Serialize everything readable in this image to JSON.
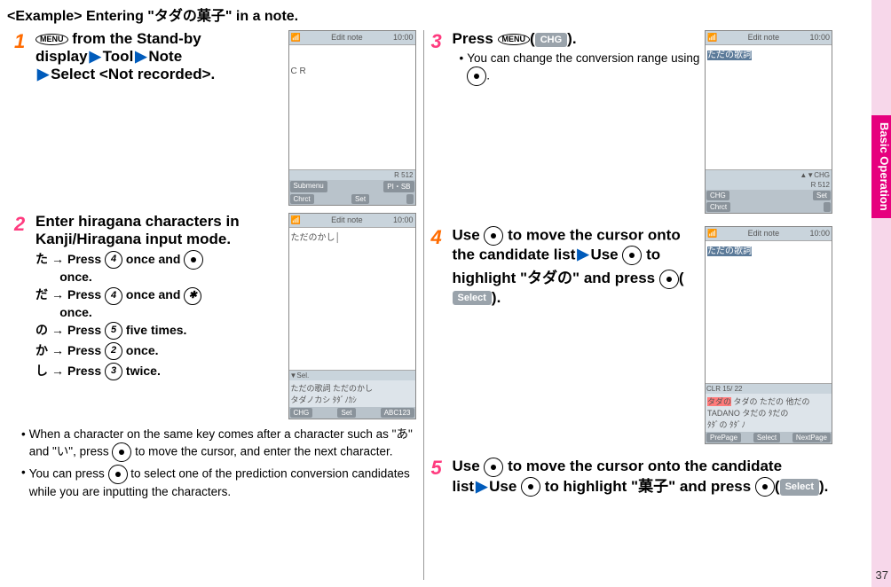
{
  "title": "<Example> Entering \"タダの菓子\" in a note.",
  "side_tab": "Basic Operation",
  "page_number": "37",
  "steps": {
    "s1": {
      "num": "1",
      "parts": {
        "menu": "MENU",
        "t1": " from the Stand-by display",
        "tool": "Tool",
        "note": "Note",
        "select": "Select <Not recorded>."
      }
    },
    "s2": {
      "num": "2",
      "head": "Enter hiragana characters in Kanji/Hiragana input mode.",
      "lines": {
        "l1a": "た",
        "l1b": "Press ",
        "l1key": "4",
        "l1c": " once and ",
        "l1d": " once.",
        "l2a": "だ",
        "l2b": "Press ",
        "l2key": "4",
        "l2c": " once and ",
        "l2star": "✱",
        "l2d": " once.",
        "l3a": "の",
        "l3b": "Press ",
        "l3key": "5",
        "l3c": " five times.",
        "l4a": "か",
        "l4b": "Press ",
        "l4key": "2",
        "l4c": " once.",
        "l5a": "し",
        "l5b": "Press ",
        "l5key": "3",
        "l5c": " twice."
      },
      "b1": "When a character on the same key comes after a character such as \"あ\" and \"い\", press ",
      "b1b": " to move the cursor, and enter the next character.",
      "b2": "You can press ",
      "b2b": " to select one of the prediction conversion candidates while you are inputting the characters."
    },
    "s3": {
      "num": "3",
      "t1": "Press ",
      "menu": "MENU",
      "soft": "CHG",
      "t2": ".",
      "b1": "You can change the conversion range using ",
      "b1b": "."
    },
    "s4": {
      "num": "4",
      "t1": "Use ",
      "t2": " to move the cursor onto the candidate list",
      "t3": "Use ",
      "t4": " to highlight \"タダの\" and press ",
      "soft": "Select",
      "t5": "."
    },
    "s5": {
      "num": "5",
      "t1": "Use ",
      "t2": " to move the cursor onto the candidate list",
      "t3": "Use ",
      "t4": " to highlight \"菓子\" and press ",
      "soft": "Select",
      "t5": "."
    }
  },
  "phones": {
    "p1": {
      "title": "Edit note",
      "status": "R 512",
      "screen": "C R",
      "soft1": "Submenu",
      "soft2": "Set",
      "soft3": "PI・SB",
      "soft0": "Chrct"
    },
    "p2": {
      "title": "Edit note",
      "screen": "ただのかし│",
      "sel": "▼Sel.",
      "cand": "ただの歌詞  ただのかし\nタダノカシ  ﾀﾀﾞﾉｶｼ",
      "soft1": "CHG",
      "soft2": "Set",
      "soft3": "ABC123"
    },
    "p3": {
      "title": "Edit note",
      "screen": "ただの歌詞",
      "status": "R 512",
      "soft1": "CHG",
      "soft2": "Set",
      "soft0": "Chrct",
      "mode": "▲▼CHG"
    },
    "p4": {
      "title": "Edit note",
      "screen": "ただの歌詞",
      "clr": "CLR           15/ 22",
      "cand": "タダの  ただの  他だの\nTADANO  タだの  ﾀだの\nﾀﾀﾞの  ﾀﾀﾞﾉ",
      "soft1": "PrePage",
      "soft2": "Select",
      "soft3": "NextPage"
    }
  }
}
